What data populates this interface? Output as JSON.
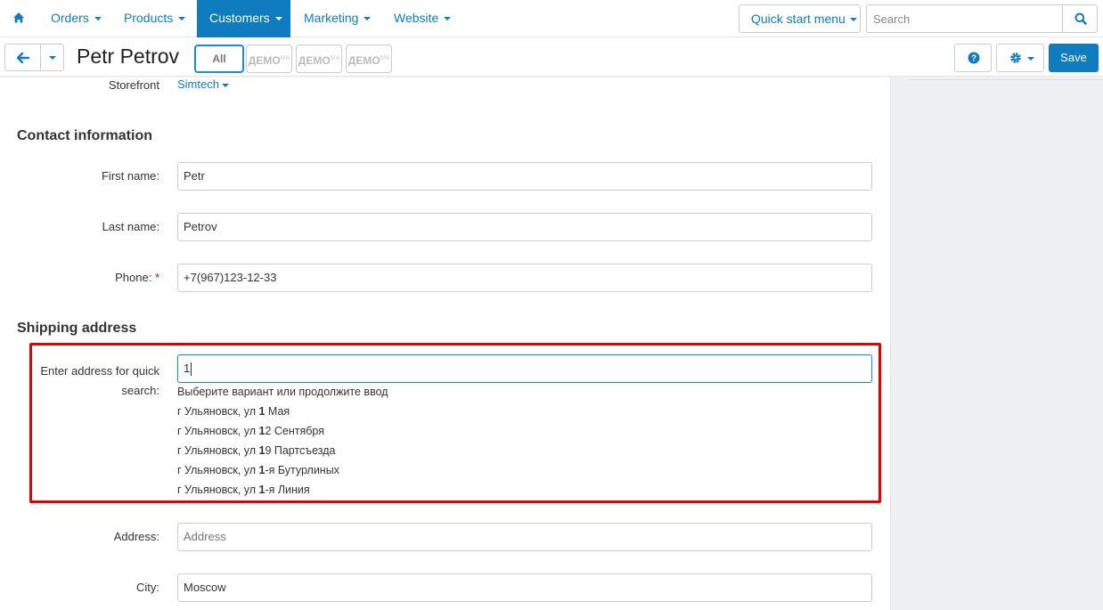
{
  "nav": {
    "items": [
      {
        "label": "Orders"
      },
      {
        "label": "Products"
      },
      {
        "label": "Customers"
      },
      {
        "label": "Marketing"
      },
      {
        "label": "Website"
      }
    ],
    "quick_start": "Quick start menu",
    "search_placeholder": "Search"
  },
  "subbar": {
    "title": "Petr Petrov",
    "tabs": [
      {
        "label": "All"
      },
      {
        "label": "ДЕМО",
        "sup": "MA"
      },
      {
        "label": "ДЕМО",
        "sup": "MA"
      },
      {
        "label": "ДЕМО",
        "sup": "MA"
      }
    ],
    "save_label": "Save"
  },
  "form": {
    "storefront_label": "Storefront",
    "storefront_value": "Simtech",
    "contact_title": "Contact information",
    "first_name_label": "First name:",
    "first_name_value": "Petr",
    "last_name_label": "Last name:",
    "last_name_value": "Petrov",
    "phone_label": "Phone:",
    "phone_required": "*",
    "phone_value": "+7(967)123-12-33",
    "shipping_title": "Shipping address",
    "quick_search_label_1": "Enter address for quick",
    "quick_search_label_2": "search:",
    "quick_search_value": "1",
    "suggest_hint": "Выберите вариант или продолжите ввод",
    "suggestions": [
      {
        "pre": "г Ульяновск, ул ",
        "match": "1",
        "post": " Мая"
      },
      {
        "pre": "г Ульяновск, ул ",
        "match": "1",
        "post": "2 Сентября"
      },
      {
        "pre": "г Ульяновск, ул ",
        "match": "1",
        "post": "9 Партсъезда"
      },
      {
        "pre": "г Ульяновск, ул ",
        "match": "1",
        "post": "-я Бутурлиных"
      },
      {
        "pre": "г Ульяновск, ул ",
        "match": "1",
        "post": "-я Линия"
      }
    ],
    "address_label": "Address:",
    "address_placeholder": "Address",
    "city_label": "City:",
    "city_value": "Moscow"
  },
  "colors": {
    "accent": "#0e7cbf",
    "highlight": "#e80000",
    "panel_bg": "#eef1f3"
  }
}
